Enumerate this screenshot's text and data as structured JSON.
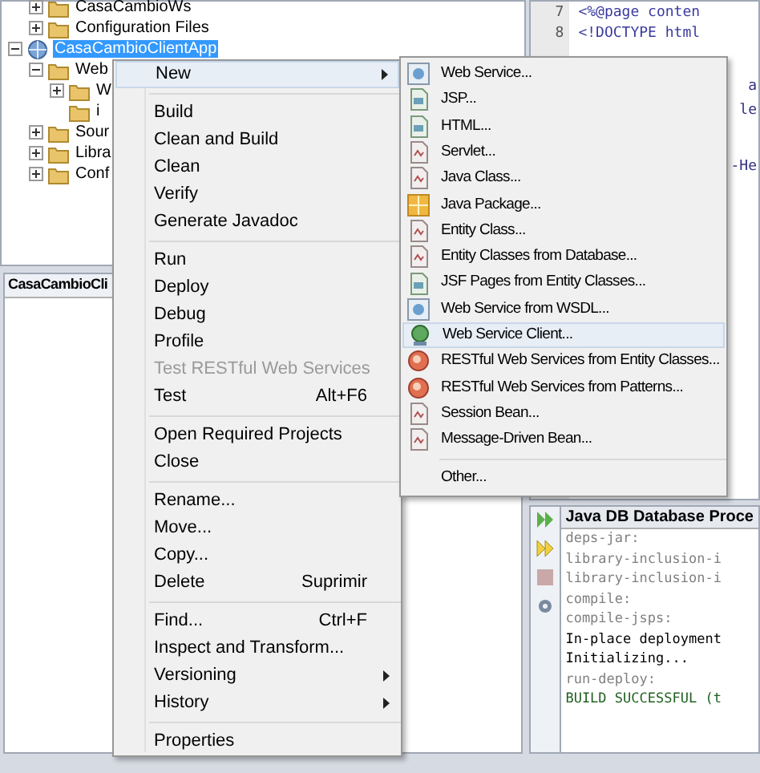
{
  "tree": {
    "continued_children": [
      {
        "label": "CasaCambioWs",
        "expanded": false
      },
      {
        "label": "Configuration Files",
        "expanded": false
      }
    ],
    "items": [
      {
        "label": "CasaCambioClientApp",
        "selected": true,
        "expanded": true,
        "children": [
          {
            "label": "Web",
            "expanded": true,
            "children": [
              {
                "label": "W",
                "expanded": false
              },
              {
                "label": "i"
              }
            ]
          },
          {
            "label": "Sour",
            "expanded": false
          },
          {
            "label": "Libra",
            "expanded": false
          },
          {
            "label": "Conf",
            "expanded": false
          }
        ]
      }
    ]
  },
  "lower_panel": {
    "tab": "CasaCambioCli"
  },
  "editor": {
    "lines": [
      {
        "number": "7",
        "code": "<%@page conten"
      },
      {
        "number": "8",
        "code": "<!DOCTYPE html"
      }
    ],
    "fragments": [
      "a",
      "le",
      "-He"
    ]
  },
  "output": {
    "tab": "Java DB Database Proce",
    "lines": [
      {
        "kind": "target",
        "text": "deps-jar:"
      },
      {
        "kind": "target",
        "text": "library-inclusion-i"
      },
      {
        "kind": "target",
        "text": "library-inclusion-i"
      },
      {
        "kind": "target",
        "text": "compile:"
      },
      {
        "kind": "target",
        "text": "compile-jsps:"
      },
      {
        "kind": "message",
        "text": "In-place deployment"
      },
      {
        "kind": "message",
        "text": "Initializing..."
      },
      {
        "kind": "target",
        "text": "run-deploy:"
      },
      {
        "kind": "success",
        "text": "BUILD SUCCESSFUL (t"
      }
    ]
  },
  "context_menu": [
    {
      "kind": "item",
      "label": "New",
      "submenu": true,
      "selected": true,
      "disabled": false
    },
    {
      "kind": "separator"
    },
    {
      "kind": "item",
      "label": "Build",
      "submenu": false,
      "selected": false,
      "disabled": false
    },
    {
      "kind": "item",
      "label": "Clean and Build",
      "submenu": false,
      "selected": false,
      "disabled": false
    },
    {
      "kind": "item",
      "label": "Clean",
      "submenu": false,
      "selected": false,
      "disabled": false
    },
    {
      "kind": "item",
      "label": "Verify",
      "submenu": false,
      "selected": false,
      "disabled": false
    },
    {
      "kind": "item",
      "label": "Generate Javadoc",
      "submenu": false,
      "selected": false,
      "disabled": false
    },
    {
      "kind": "separator"
    },
    {
      "kind": "item",
      "label": "Run",
      "submenu": false,
      "selected": false,
      "disabled": false
    },
    {
      "kind": "item",
      "label": "Deploy",
      "submenu": false,
      "selected": false,
      "disabled": false
    },
    {
      "kind": "item",
      "label": "Debug",
      "submenu": false,
      "selected": false,
      "disabled": false
    },
    {
      "kind": "item",
      "label": "Profile",
      "submenu": false,
      "selected": false,
      "disabled": false
    },
    {
      "kind": "item",
      "label": "Test RESTful Web Services",
      "submenu": false,
      "selected": false,
      "disabled": true
    },
    {
      "kind": "item",
      "label": "Test",
      "shortcut": "Alt+F6",
      "submenu": false,
      "selected": false,
      "disabled": false
    },
    {
      "kind": "separator"
    },
    {
      "kind": "item",
      "label": "Open Required Projects",
      "submenu": false,
      "selected": false,
      "disabled": false
    },
    {
      "kind": "item",
      "label": "Close",
      "submenu": false,
      "selected": false,
      "disabled": false
    },
    {
      "kind": "separator"
    },
    {
      "kind": "item",
      "label": "Rename...",
      "submenu": false,
      "selected": false,
      "disabled": false
    },
    {
      "kind": "item",
      "label": "Move...",
      "submenu": false,
      "selected": false,
      "disabled": false
    },
    {
      "kind": "item",
      "label": "Copy...",
      "submenu": false,
      "selected": false,
      "disabled": false
    },
    {
      "kind": "item",
      "label": "Delete",
      "shortcut": "Suprimir",
      "submenu": false,
      "selected": false,
      "disabled": false
    },
    {
      "kind": "separator"
    },
    {
      "kind": "item",
      "label": "Find...",
      "shortcut": "Ctrl+F",
      "submenu": false,
      "selected": false,
      "disabled": false
    },
    {
      "kind": "item",
      "label": "Inspect and Transform...",
      "submenu": false,
      "selected": false,
      "disabled": false
    },
    {
      "kind": "item",
      "label": "Versioning",
      "submenu": true,
      "selected": false,
      "disabled": false
    },
    {
      "kind": "item",
      "label": "History",
      "submenu": true,
      "selected": false,
      "disabled": false
    },
    {
      "kind": "separator"
    },
    {
      "kind": "item",
      "label": "Properties",
      "submenu": false,
      "selected": false,
      "disabled": false
    }
  ],
  "new_submenu": [
    {
      "kind": "service",
      "label": "Web Service...",
      "selected": false
    },
    {
      "kind": "page",
      "label": "JSP...",
      "selected": false
    },
    {
      "kind": "page",
      "label": "HTML...",
      "selected": false
    },
    {
      "kind": "class",
      "label": "Servlet...",
      "selected": false
    },
    {
      "kind": "class",
      "label": "Java Class...",
      "selected": false
    },
    {
      "kind": "package",
      "label": "Java Package...",
      "selected": false
    },
    {
      "kind": "class",
      "label": "Entity Class...",
      "selected": false
    },
    {
      "kind": "class",
      "label": "Entity Classes from Database...",
      "selected": false
    },
    {
      "kind": "page",
      "label": "JSF Pages from Entity Classes...",
      "selected": false
    },
    {
      "kind": "service",
      "label": "Web Service from WSDL...",
      "selected": false
    },
    {
      "kind": "client",
      "label": "Web Service Client...",
      "selected": true
    },
    {
      "kind": "rest",
      "label": "RESTful Web Services from Entity Classes...",
      "selected": false
    },
    {
      "kind": "rest",
      "label": "RESTful Web Services from Patterns...",
      "selected": false
    },
    {
      "kind": "class",
      "label": "Session Bean...",
      "selected": false
    },
    {
      "kind": "class",
      "label": "Message-Driven Bean...",
      "selected": false
    },
    {
      "kind": "separator"
    },
    {
      "kind": "plain",
      "label": "Other...",
      "selected": false
    }
  ]
}
